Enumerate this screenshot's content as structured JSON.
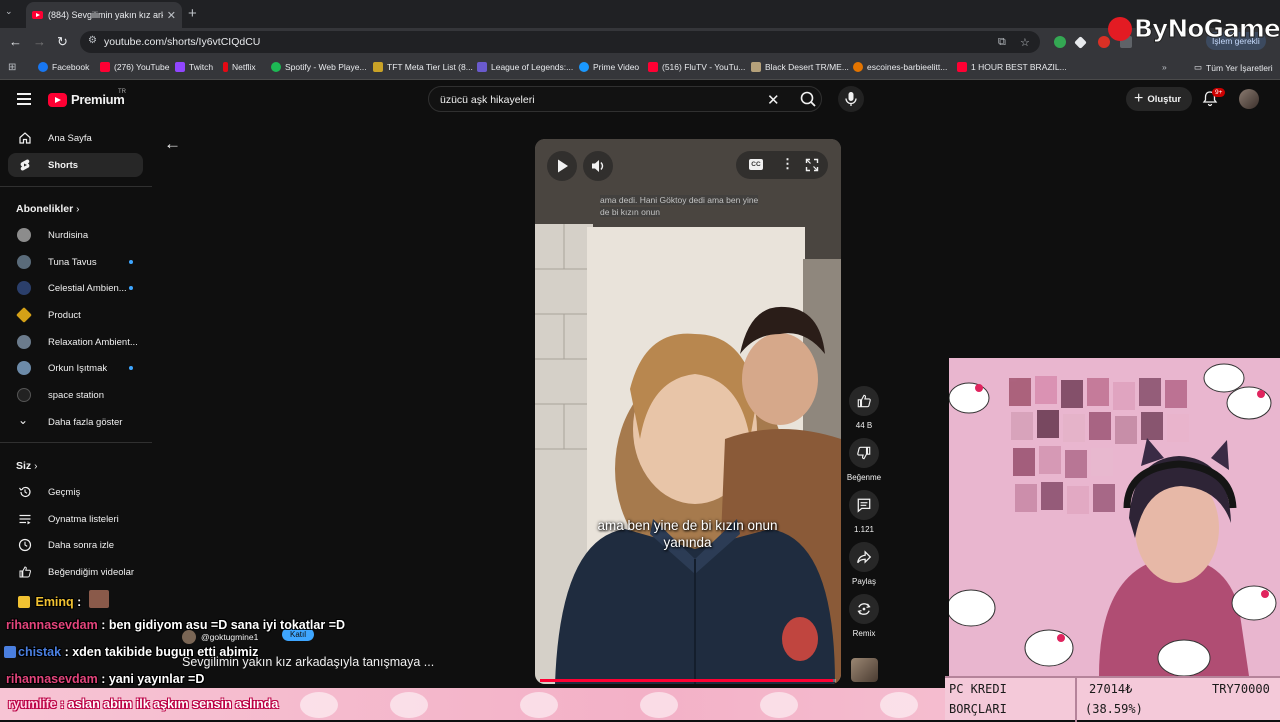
{
  "browser": {
    "tab_title": "(884) Sevgilimin yakın kız arkad",
    "url": "youtube.com/shorts/Iy6vtCIQdCU",
    "profile_status": "İşlem gerekli",
    "bookmarks": [
      "Facebook",
      "(276) YouTube",
      "Twitch",
      "Netflix",
      "Spotify - Web Playe...",
      "TFT Meta Tier List (8...",
      "League of Legends:...",
      "Prime Video",
      "(516) FluTV - YouTu...",
      "Black Desert TR/ME...",
      "escoines-barbieelitt...",
      "1 HOUR BEST BRAZIL..."
    ],
    "bookmarks_folder": "Tüm Yer İşaretleri"
  },
  "youtube": {
    "logo_text": "Premium",
    "logo_region": "TR",
    "search_value": "üzücü aşk hikayeleri",
    "create_label": "Oluştur",
    "notif_count": "9+",
    "sidebar": {
      "main": [
        {
          "label": "Ana Sayfa",
          "icon": "home-icon"
        },
        {
          "label": "Shorts",
          "icon": "shorts-icon"
        }
      ],
      "subs_heading": "Abonelikler",
      "subscriptions": [
        {
          "label": "Nurdisina",
          "color": "#8c8c8c",
          "dot": false
        },
        {
          "label": "Tuna Tavus",
          "color": "#5a6b7a",
          "dot": true
        },
        {
          "label": "Celestial Ambien...",
          "color": "#2b3f6b",
          "dot": true
        },
        {
          "label": "Product",
          "color": "#d4a017",
          "dot": false
        },
        {
          "label": "Relaxation Ambient...",
          "color": "#6b7b8c",
          "dot": false
        },
        {
          "label": "Orkun Işıtmak",
          "color": "#6c8aa8",
          "dot": true
        },
        {
          "label": "space station",
          "color": "#222222",
          "dot": false
        }
      ],
      "show_more": "Daha fazla göster",
      "you_heading": "Siz",
      "you_items": [
        {
          "label": "Geçmiş",
          "icon": "history-icon"
        },
        {
          "label": "Oynatma listeleri",
          "icon": "playlists-icon"
        },
        {
          "label": "Daha sonra izle",
          "icon": "watch-later-icon"
        },
        {
          "label": "Beğendiğim videolar",
          "icon": "liked-icon"
        }
      ]
    },
    "short": {
      "caption_dim_1": "ama dedi. Hani Göktoy dedi ama ben yine",
      "caption_dim_2": "de bi kızın onun",
      "caption_main_1": "ama ben yine de bi kızın onun",
      "caption_main_2": "yanında",
      "progress": 0.99,
      "author": "@goktugmine1",
      "join_label": "Katıl",
      "title": "Sevgilimin yakın kız arkadaşıyla tanışmaya ..."
    },
    "actions": {
      "like_count": "44 B",
      "dislike_label": "Beğenme",
      "comment_count": "1.121",
      "share_label": "Paylaş",
      "remix_label": "Remix"
    }
  },
  "overlay": {
    "watermark": "ByNoGame",
    "chat": [
      {
        "name": "Eminq",
        "text": " :",
        "color": "#f1c232"
      },
      {
        "name": "rihannasevdam",
        "text": " : ben gidiyom asu =D sana iyi tokatlar =D",
        "color": "#e2447b"
      },
      {
        "name": "chistak",
        "text": " : xden takibide bugun etti abimiz",
        "color": "#4a7fe0"
      },
      {
        "name": "rihannasevdam",
        "text": " : yani yayınlar =D",
        "color": "#e2447b"
      }
    ],
    "pinned": {
      "name": "ryumlife",
      "text": " : aslan abim ilk aşkım sensin aslında"
    },
    "debt": {
      "label_1": "PC KREDI",
      "label_2": "BORÇLARI",
      "amount": "27014₺",
      "percent": "(38.59%)",
      "target": "TRY70000"
    }
  }
}
